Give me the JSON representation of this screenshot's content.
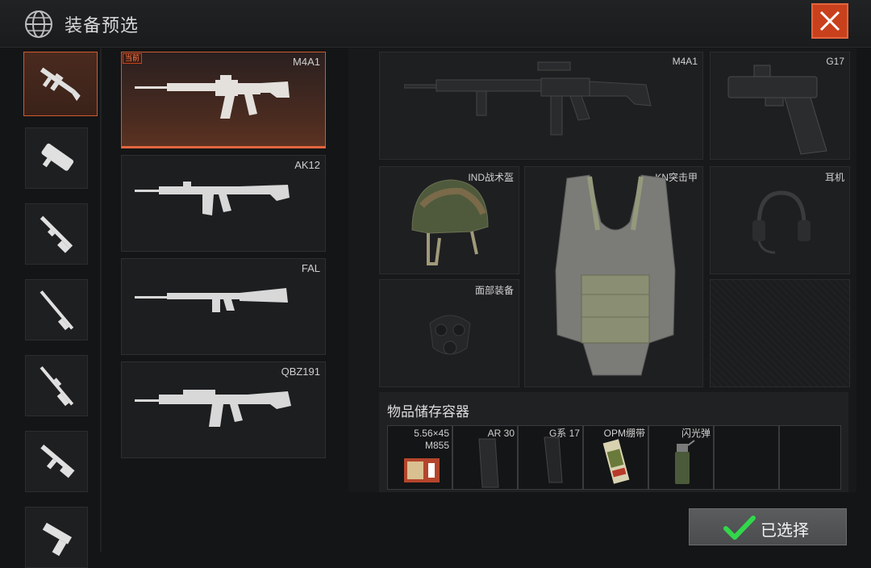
{
  "header": {
    "title": "装备预选"
  },
  "weapons": [
    {
      "name": "M4A1",
      "badge": "当前",
      "selected": true
    },
    {
      "name": "AK12"
    },
    {
      "name": "FAL"
    },
    {
      "name": "QBZ191"
    }
  ],
  "categories": [
    "assault-rifle",
    "smg",
    "shotgun",
    "sniper-rifle",
    "marksman-rifle",
    "lmg",
    "pistol"
  ],
  "loadout": {
    "primary": "M4A1",
    "secondary": "G17",
    "helmet": "IND战术盔",
    "armor": "KN突击甲",
    "headset": "耳机",
    "face": "面部装备"
  },
  "storage": {
    "title": "物品储存容器",
    "items": [
      {
        "label_line1": "5.56×45",
        "label_line2": "M855"
      },
      {
        "label_line1": "AR 30",
        "label_line2": ""
      },
      {
        "label_line1": "G系 17",
        "label_line2": ""
      },
      {
        "label_line1": "OPM绷带",
        "label_line2": ""
      },
      {
        "label_line1": "闪光弹",
        "label_line2": ""
      },
      {
        "label_line1": "",
        "label_line2": ""
      },
      {
        "label_line1": "",
        "label_line2": ""
      }
    ]
  },
  "confirm": {
    "label": "已选择"
  },
  "colors": {
    "accent": "#c9411c",
    "check": "#32d74b"
  }
}
